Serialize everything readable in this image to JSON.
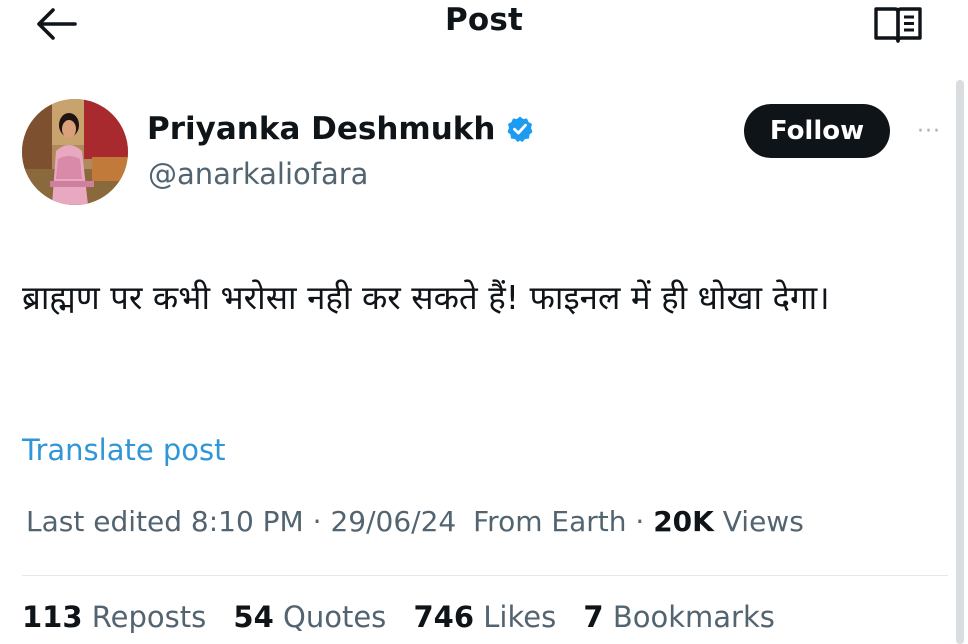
{
  "header": {
    "title": "Post",
    "back_icon": "arrow-left-icon",
    "reader_icon": "reader-mode-icon"
  },
  "author": {
    "name": "Priyanka Deshmukh",
    "handle": "@anarkaliofara",
    "verified_color": "#1d9bf0",
    "follow_label": "Follow",
    "more_icon": "more-horizontal-icon",
    "more_label": "···"
  },
  "post": {
    "text": "ब्राह्मण पर कभी भरोसा नही कर सकते हैं! फाइनल में ही धोखा देगा।",
    "translate_label": "Translate post",
    "edited_prefix": "Last edited",
    "time": "8:10 PM",
    "sep": "·",
    "date": "29/06/24",
    "source": "From Earth",
    "views_count": "20K",
    "views_label": "Views"
  },
  "stats": [
    {
      "count": "113",
      "label": "Reposts"
    },
    {
      "count": "54",
      "label": "Quotes"
    },
    {
      "count": "746",
      "label": "Likes"
    },
    {
      "count": "7",
      "label": "Bookmarks"
    }
  ],
  "colors": {
    "text": "#0f1419",
    "secondary": "#536471",
    "link": "#3196d6",
    "verified": "#1d9bf0"
  }
}
